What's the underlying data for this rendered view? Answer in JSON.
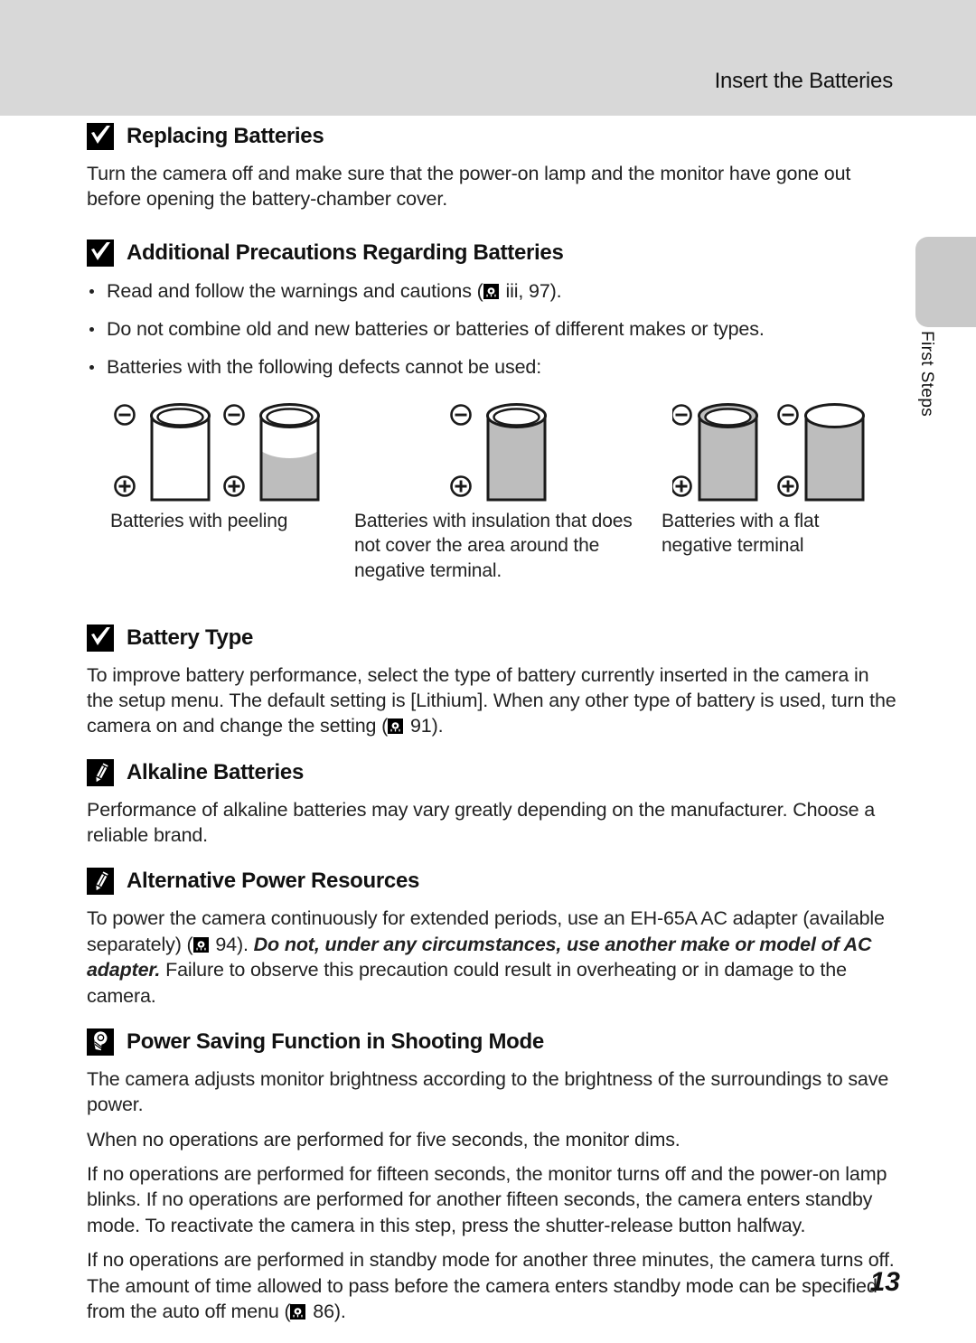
{
  "header": {
    "title": "Insert the Batteries"
  },
  "side_tab": {
    "label": "First Steps"
  },
  "sections": [
    {
      "icon": "caution-check-icon",
      "title": "Replacing Batteries",
      "paragraphs": [
        "Turn the camera off and make sure that the power-on lamp and the monitor have gone out before opening the battery-chamber cover."
      ]
    },
    {
      "icon": "caution-check-icon",
      "title": "Additional Precautions Regarding Batteries",
      "bullets": [
        {
          "pre": "Read and follow the warnings and cautions (",
          "icon": "book-reference-icon",
          "post": " iii, 97)."
        },
        {
          "pre": "Do not combine old and new batteries or batteries of different makes or types.",
          "icon": null,
          "post": ""
        },
        {
          "pre": "Batteries with the following defects cannot be used:",
          "icon": null,
          "post": ""
        }
      ]
    },
    {
      "icon": "caution-check-icon",
      "title": "Battery Type",
      "paragraphs": [
        "To improve battery performance, select the type of battery currently inserted in the camera in the setup menu. The default setting is [Lithium]. When any other type of battery is used, turn the camera on and change the setting ("
      ],
      "paragraph_icon": "book-reference-icon",
      "paragraph_tail": " 91)."
    },
    {
      "icon": "note-pencil-icon",
      "title": "Alkaline Batteries",
      "paragraphs": [
        "Performance of alkaline batteries may vary greatly depending on the manufacturer. Choose a reliable brand."
      ]
    },
    {
      "icon": "note-pencil-icon",
      "title": "Alternative Power Resources",
      "para_a": "To power the camera continuously for extended periods, use an EH-65A AC adapter (available separately) (",
      "para_icon": "book-reference-icon",
      "para_b": " 94). ",
      "para_bold": "Do not, under any circumstances, use another make or model of AC adapter.",
      "para_c": " Failure to observe this precaution could result in overheating or in damage to the camera."
    },
    {
      "icon": "lightbulb-tip-icon",
      "title": "Power Saving Function in Shooting Mode",
      "paragraphs": [
        "The camera adjusts monitor brightness according to the brightness of the surroundings to save power.",
        "When no operations are performed for five seconds, the monitor dims.",
        "If no operations are performed for fifteen seconds, the monitor turns off and the power-on lamp blinks. If no operations are performed for another fifteen seconds, the camera enters standby mode. To reactivate the camera in this step, press the shutter-release button halfway."
      ],
      "last_para_a": "If no operations are performed in standby mode for another three minutes, the camera turns off. The amount of time allowed to pass before the camera enters standby mode can be specified from the auto off menu (",
      "last_para_icon": "book-reference-icon",
      "last_para_b": " 86)."
    }
  ],
  "figure": {
    "captions": [
      "Batteries with peeling",
      "Batteries with insulation that does not cover the area around the negative terminal.",
      "Batteries with a flat negative terminal"
    ]
  },
  "page_number": "13",
  "colors": {
    "header_band": "#d8d8d8",
    "side_tab": "#c9c9c9",
    "battery_gray": "#bdbdbd",
    "text": "#222222"
  }
}
